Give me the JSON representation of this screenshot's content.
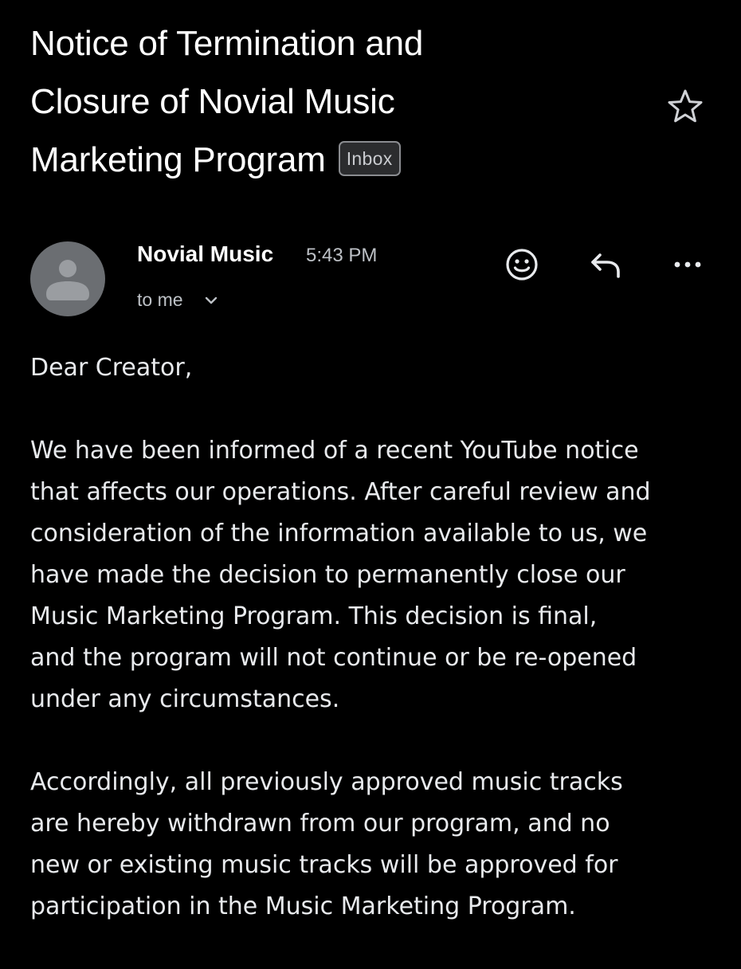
{
  "email": {
    "subject_lines": [
      "Notice of Termination and",
      "Closure of Novial Music",
      "Marketing Program"
    ],
    "label": "Inbox",
    "sender": "Novial Music",
    "time": "5:43 PM",
    "recipient": "to me",
    "greeting": "Dear Creator,",
    "paragraph1_lines": [
      "We have been informed of a recent YouTube notice",
      "that affects our operations. After careful review and",
      "consideration of the information available to us, we",
      "have made the decision to permanently close our",
      "Music Marketing Program. This decision is final,",
      "and the program will not continue or be re-opened",
      "under any circumstances."
    ],
    "paragraph2_lines": [
      "Accordingly, all previously approved music tracks",
      "are hereby withdrawn from our program, and no",
      "new or existing music tracks will be approved for",
      "participation in the Music Marketing Program."
    ]
  },
  "icons": {
    "star": "star-icon",
    "emoji": "emoji-icon",
    "reply": "reply-icon",
    "more": "more-icon",
    "chevron": "chevron-down-icon",
    "avatar": "avatar"
  },
  "colors": {
    "background": "#000000",
    "text": "#e8eaed",
    "secondary_text": "#bdc1c6",
    "avatar": "#6b6e72"
  }
}
